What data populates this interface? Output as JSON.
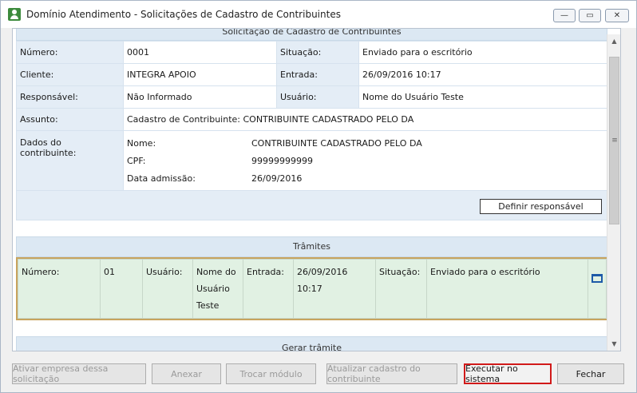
{
  "window": {
    "title": "Domínio Atendimento - Solicitações de Cadastro de Contribuintes",
    "minimize_glyph": "—",
    "maximize_glyph": "▭",
    "close_glyph": "✕"
  },
  "request": {
    "section_title": "Solicitação de Cadastro de Contribuintes",
    "numero_label": "Número:",
    "numero_value": "0001",
    "situacao_label": "Situação:",
    "situacao_value": "Enviado para o escritório",
    "cliente_label": "Cliente:",
    "cliente_value": "INTEGRA APOIO",
    "entrada_label": "Entrada:",
    "entrada_value": "26/09/2016 10:17",
    "responsavel_label": "Responsável:",
    "responsavel_value": "Não Informado",
    "usuario_label": "Usuário:",
    "usuario_value": "Nome do Usuário Teste",
    "assunto_label": "Assunto:",
    "assunto_value": "Cadastro de Contribuinte: CONTRIBUINTE CADASTRADO PELO DA",
    "dados_label": "Dados do contribuinte:",
    "dados": {
      "nome_label": "Nome:",
      "nome_value": "CONTRIBUINTE CADASTRADO PELO DA",
      "cpf_label": "CPF:",
      "cpf_value": "99999999999",
      "admissao_label": "Data admissão:",
      "admissao_value": "26/09/2016"
    },
    "definir_button": "Definir responsável"
  },
  "tramites": {
    "section_title": "Trâmites",
    "row": {
      "numero_label": "Número:",
      "numero_value": "01",
      "usuario_label": "Usuário:",
      "usuario_value_lines": [
        "Nome do",
        "Usuário",
        "Teste"
      ],
      "entrada_label": "Entrada:",
      "entrada_value": "26/09/2016 10:17",
      "situacao_label": "Situação:",
      "situacao_value": "Enviado para o escritório",
      "icon": "folder-icon"
    }
  },
  "gerar": {
    "section_title": "Gerar trâmite"
  },
  "footer": {
    "ativar": "Ativar empresa dessa solicitação",
    "anexar": "Anexar",
    "trocar": "Trocar módulo",
    "atualizar": "Atualizar cadastro do contribuinte",
    "executar": "Executar no sistema",
    "fechar": "Fechar"
  }
}
